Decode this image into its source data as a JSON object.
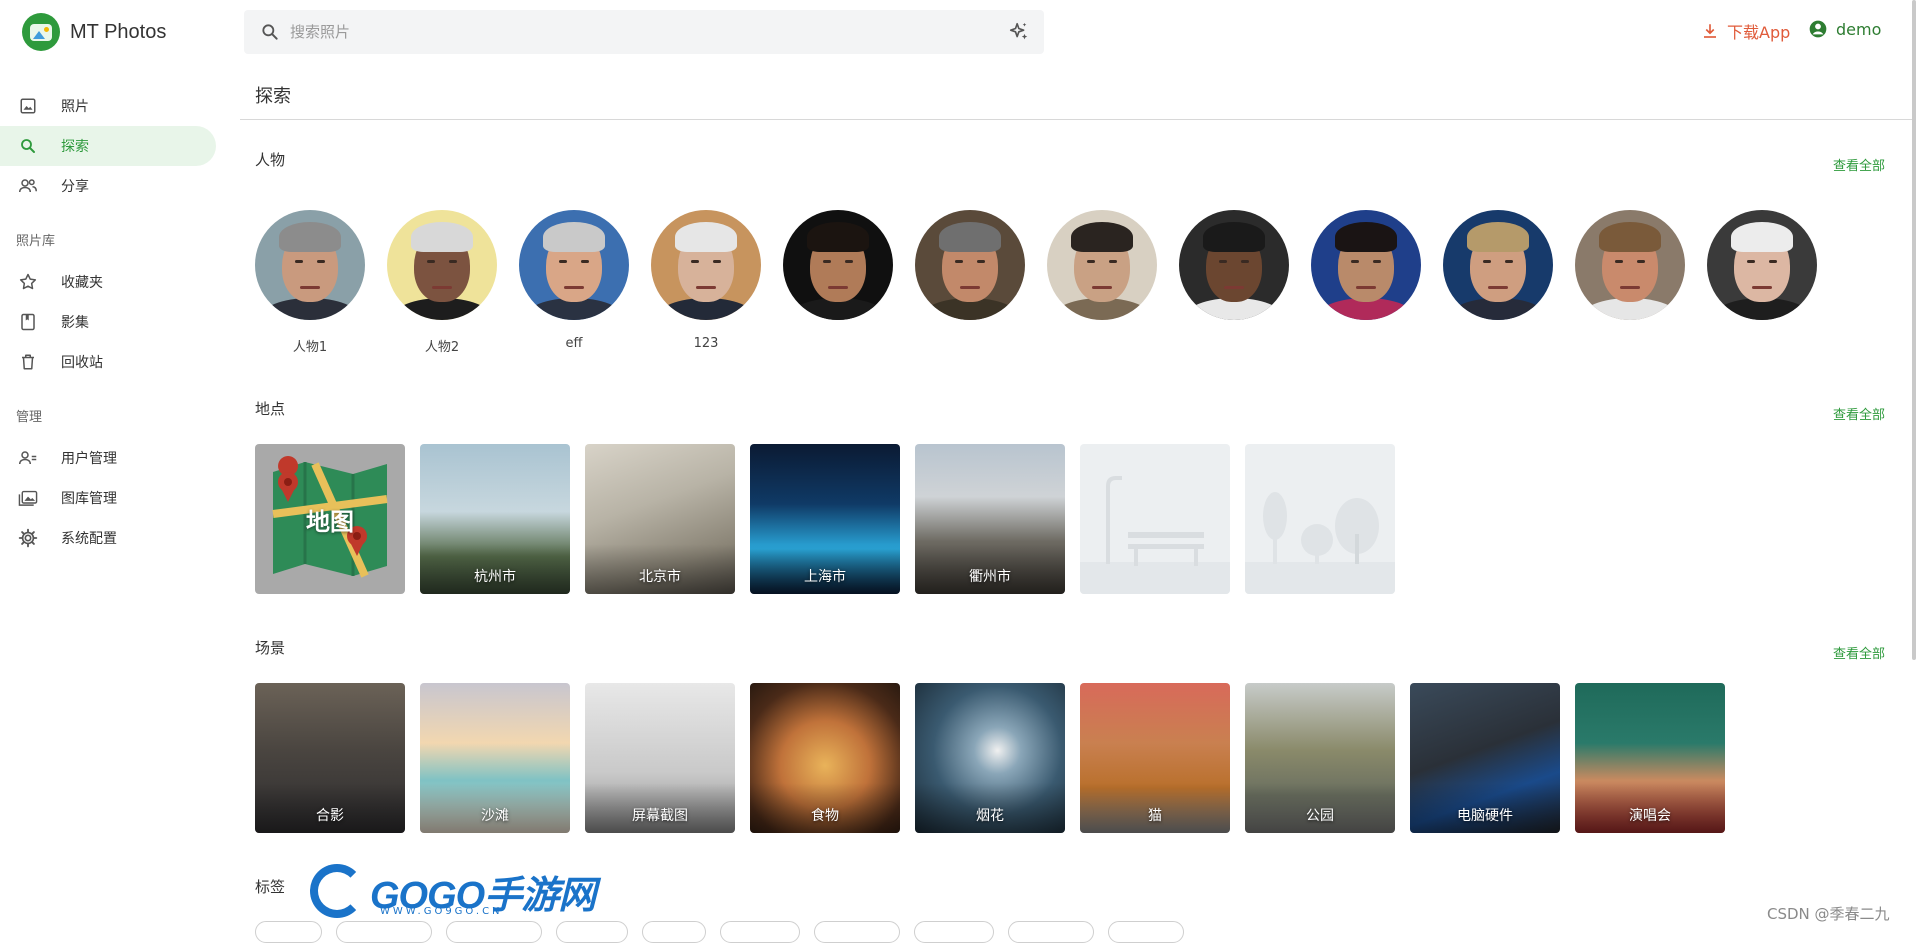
{
  "app": {
    "title": "MT Photos"
  },
  "sidebar": {
    "main_items": [
      {
        "label": "照片",
        "icon": "image-icon"
      },
      {
        "label": "探索",
        "icon": "search-icon"
      },
      {
        "label": "分享",
        "icon": "people-icon"
      }
    ],
    "library_section": "照片库",
    "library_items": [
      {
        "label": "收藏夹",
        "icon": "star-icon"
      },
      {
        "label": "影集",
        "icon": "album-icon"
      },
      {
        "label": "回收站",
        "icon": "trash-icon"
      }
    ],
    "admin_section": "管理",
    "admin_items": [
      {
        "label": "用户管理",
        "icon": "user-manage-icon"
      },
      {
        "label": "图库管理",
        "icon": "library-manage-icon"
      },
      {
        "label": "系统配置",
        "icon": "gear-icon"
      }
    ]
  },
  "header": {
    "search_placeholder": "搜索照片",
    "download_label": "下载App",
    "user_name": "demo"
  },
  "page": {
    "title": "探索"
  },
  "people": {
    "title": "人物",
    "see_all": "查看全部",
    "items": [
      {
        "name": "人物1",
        "skin": "#c99a7e",
        "hair": "#8c8c8c",
        "bg": "#8aa0a8",
        "body": "#2b2f3a"
      },
      {
        "name": "人物2",
        "skin": "#7c5340",
        "hair": "#d8d8d8",
        "bg": "#efe39a",
        "body": "#1d1d1d"
      },
      {
        "name": "eff",
        "skin": "#d9a687",
        "hair": "#c9c9c9",
        "bg": "#3c6fb0",
        "body": "#2a3242"
      },
      {
        "name": "123",
        "skin": "#d7b29a",
        "hair": "#e6e6e6",
        "bg": "#c7945e",
        "body": "#232a38"
      },
      {
        "name": "",
        "skin": "#b07b58",
        "hair": "#1b1410",
        "bg": "#101010",
        "body": "#1a1a1a"
      },
      {
        "name": "",
        "skin": "#c2896a",
        "hair": "#6f6f6f",
        "bg": "#5a4a3a",
        "body": "#3b3326"
      },
      {
        "name": "",
        "skin": "#c9a184",
        "hair": "#2a2420",
        "bg": "#d8d0c2",
        "body": "#7b6a54"
      },
      {
        "name": "",
        "skin": "#6b4630",
        "hair": "#1a1a1a",
        "bg": "#2b2b2b",
        "body": "#e8e8e8"
      },
      {
        "name": "",
        "skin": "#b98a6a",
        "hair": "#1a1414",
        "bg": "#1f3f8a",
        "body": "#b02a5a"
      },
      {
        "name": "",
        "skin": "#cf9e80",
        "hair": "#b59a6a",
        "bg": "#173a6b",
        "body": "#262b3a"
      },
      {
        "name": "",
        "skin": "#c98a6c",
        "hair": "#7a5a3a",
        "bg": "#8a7a6a",
        "body": "#e6e6e6"
      },
      {
        "name": "",
        "skin": "#dcb7a3",
        "hair": "#ececec",
        "bg": "#3a3a3a",
        "body": "#1e1e1e"
      }
    ]
  },
  "places": {
    "title": "地点",
    "see_all": "查看全部",
    "map_label": "地图",
    "items": [
      {
        "name": "杭州市",
        "bg": "linear-gradient(180deg,#a9c3d1 0%,#c7d7de 45%,#556b4a 75%,#3a4a36 100%)"
      },
      {
        "name": "北京市",
        "bg": "linear-gradient(160deg,#d8d3c8 0%,#b8b3a6 40%,#8a8476 75%,#5a554d 100%)"
      },
      {
        "name": "上海市",
        "bg": "linear-gradient(180deg,#0b1a33 0%,#0f3a66 40%,#2aa6d9 70%,#0a1e3a 100%)"
      },
      {
        "name": "衢州市",
        "bg": "linear-gradient(180deg,#b8c4cf 0%,#cfd3d6 35%,#6d6a62 65%,#3e3a34 100%)"
      },
      {
        "name": "",
        "bg": "#eceff1"
      },
      {
        "name": "",
        "bg": "#eceff1"
      }
    ]
  },
  "scenes": {
    "title": "场景",
    "see_all": "查看全部",
    "items": [
      {
        "name": "合影",
        "bg": "linear-gradient(180deg,#6b6257 0%,#4a4540 45%,#2d2c2e 100%)"
      },
      {
        "name": "沙滩",
        "bg": "linear-gradient(180deg,#c8c6cf 0%,#f2d7b0 40%,#7fc2c4 65%,#e8dccb 100%)"
      },
      {
        "name": "屏幕截图",
        "bg": "linear-gradient(180deg,#e8e8e8 0%,#c9c9c9 60%,#8a8a8a 100%)"
      },
      {
        "name": "食物",
        "bg": "radial-gradient(circle at 50% 55%,#e9b35a 0%,#c0723a 40%,#4a2a18 75%,#2a1a10 100%)"
      },
      {
        "name": "烟花",
        "bg": "radial-gradient(circle at 55% 45%,#f0f0f0 0%,#8aa6b8 20%,#3a5a70 55%,#1a2a36 100%)"
      },
      {
        "name": "猫",
        "bg": "linear-gradient(180deg,#d86a5a 0%,#c98050 40%,#b9702c 70%,#8a8a8a 100%)"
      },
      {
        "name": "公园",
        "bg": "linear-gradient(180deg,#c7cbc9 0%,#8a8a6a 45%,#6a6f60 75%,#7a7a78 100%)"
      },
      {
        "name": "电脑硬件",
        "bg": "linear-gradient(160deg,#3a4a5a 0%,#2a3038 45%,#1a4a8a 70%,#20242a 100%)"
      },
      {
        "name": "演唱会",
        "bg": "linear-gradient(180deg,#1f6a5a 0%,#2a7a6a 40%,#c98a60 65%,#9a2a2a 100%)"
      }
    ]
  },
  "tags": {
    "title": "标签"
  },
  "watermark": {
    "brand": "GOGO手游网",
    "url": "WWW.GO9GO.CN",
    "credit": "CSDN @季春二九"
  },
  "colors": {
    "accent": "#2e9a3c",
    "download": "#e05b3a",
    "active_bg": "#e8f5e9"
  }
}
